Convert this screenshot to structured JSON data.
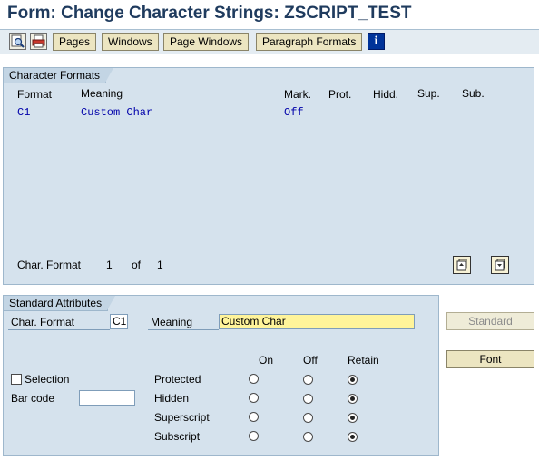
{
  "window": {
    "title": "Form: Change Character Strings: ZSCRIPT_TEST"
  },
  "toolbar": {
    "icons": [
      "search-doc-icon",
      "print-icon"
    ],
    "buttons": [
      "Pages",
      "Windows",
      "Page Windows",
      "Paragraph Formats"
    ],
    "info_icon": "i"
  },
  "char_formats": {
    "title": "Character Formats",
    "columns": {
      "format": "Format",
      "meaning": "Meaning",
      "mark": "Mark.",
      "prot": "Prot.",
      "hidd": "Hidd.",
      "sup": "Sup.",
      "sub": "Sub."
    },
    "rows": [
      {
        "format": "C1",
        "meaning": "Custom Char",
        "mark": "Off"
      }
    ],
    "footer": {
      "label": "Char. Format",
      "current": "1",
      "of": "of",
      "total": "1"
    }
  },
  "std_attrs": {
    "title": "Standard Attributes",
    "char_format_label": "Char. Format",
    "char_format_value": "C1",
    "meaning_label": "Meaning",
    "meaning_value": "Custom Char",
    "col_on": "On",
    "col_off": "Off",
    "col_retain": "Retain",
    "selection_label": "Selection",
    "selection_checked": false,
    "barcode_label": "Bar code",
    "barcode_value": "",
    "rows": [
      {
        "label": "Protected",
        "selected": "retain"
      },
      {
        "label": "Hidden",
        "selected": "retain"
      },
      {
        "label": "Superscript",
        "selected": "retain"
      },
      {
        "label": "Subscript",
        "selected": "retain"
      }
    ]
  },
  "side_buttons": {
    "standard": "Standard",
    "font": "Font"
  }
}
